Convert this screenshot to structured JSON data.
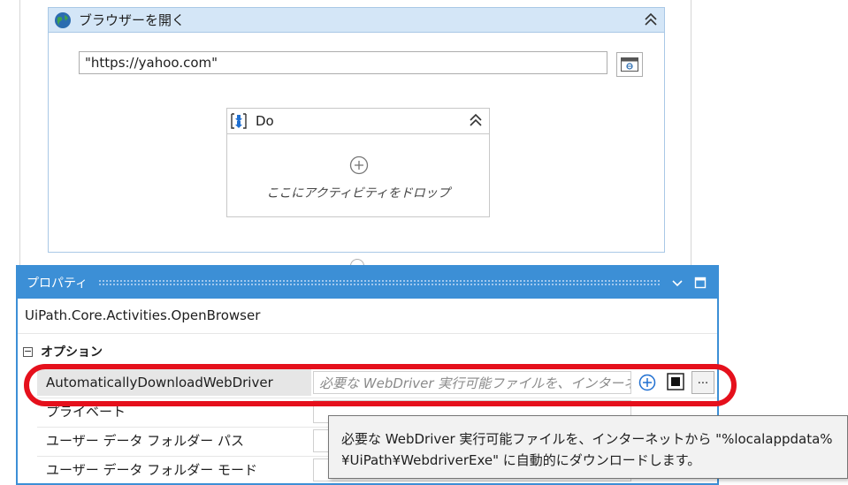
{
  "activity": {
    "title": "ブラウザーを開く",
    "url_value": "\"https://yahoo.com\""
  },
  "do_block": {
    "title": "Do",
    "drop_hint": "ここにアクティビティをドロップ"
  },
  "properties_panel": {
    "title": "プロパティ",
    "type_name": "UiPath.Core.Activities.OpenBrowser",
    "category": {
      "toggle": "−",
      "label": "オプション"
    },
    "rows": [
      {
        "name": "AutomaticallyDownloadWebDriver",
        "value": "必要な WebDriver 実行可能ファイルを、インターネットから",
        "selected": true
      },
      {
        "name": "プライベート",
        "value": ""
      },
      {
        "name": "ユーザー データ フォルダー パス",
        "value": ""
      },
      {
        "name": "ユーザー データ フォルダー モード",
        "value": ""
      }
    ],
    "more_button_label": "..."
  },
  "tooltip": {
    "line1": "必要な WebDriver 実行可能ファイルを、インターネットから \"%localappdata%",
    "line2": "¥UiPath¥WebdriverExe\" に自動的にダウンロードします。"
  },
  "colors": {
    "panel_accent": "#3c8fd6",
    "activity_header": "#d4e6f7",
    "highlight": "#e5101c"
  },
  "icons": [
    "globe-icon",
    "collapse-chevron-icon",
    "browser-window-icon",
    "do-sequence-icon",
    "add-circle-icon",
    "dropdown-arrow-icon",
    "maximize-icon",
    "expression-icon"
  ]
}
